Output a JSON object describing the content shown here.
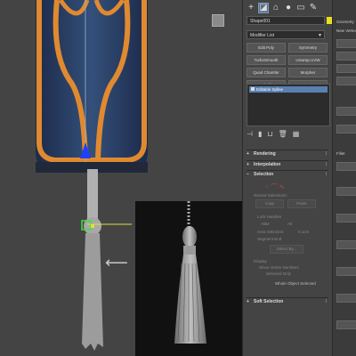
{
  "command_panel": {
    "toolbar": {
      "create_icon": "plus-icon",
      "modify_icon": "modify-icon",
      "hierarchy_icon": "hierarchy-icon",
      "motion_icon": "motion-icon",
      "display_icon": "display-icon",
      "utilities_icon": "wrench-icon"
    },
    "object_name": "Shape001",
    "object_color": "#e8e020",
    "modifier_list_label": "Modifier List",
    "buttons": [
      "Edit Poly",
      "Symmetry",
      "TurboSmooth",
      "Unwrap UVW",
      "Quad Chamfer",
      "Morpher",
      "Shell",
      "Bend"
    ],
    "stack_items": [
      "Editable Spline"
    ],
    "rollouts": {
      "rendering": "Rendering",
      "interpolation": "Interpolation",
      "selection": "Selection",
      "soft_selection": "Soft Selection"
    },
    "selection": {
      "named_selections": "Named Selections:",
      "copy": "Copy",
      "paste": "Paste",
      "lock_handles": "Lock Handles",
      "alike": "Alike",
      "all": "All",
      "area_selection": "Area Selection:",
      "area_value": "0.1cm",
      "segment_end": "Segment End",
      "select_by": "Select By...",
      "display": "Display",
      "show_vertex_numbers": "Show Vertex Numbers",
      "selected_only": "Selected Only",
      "status": "Whole Object Selected"
    }
  },
  "far_panel": {
    "geometry": "Geometry",
    "new_vertex_type": "New Vertex Type",
    "fillet": "Fillet"
  }
}
